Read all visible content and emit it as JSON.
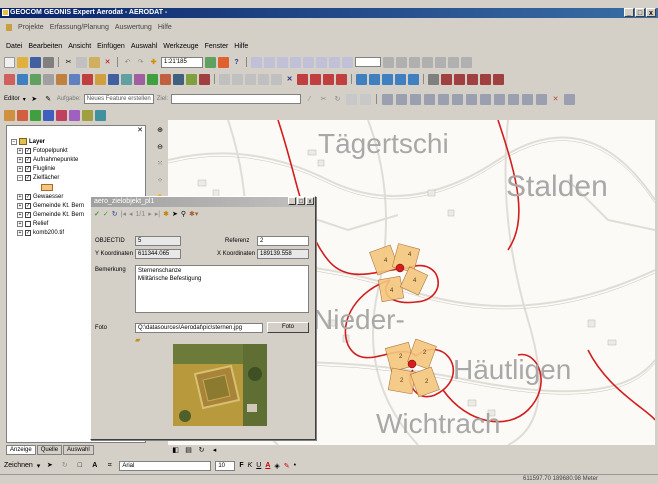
{
  "window": {
    "title": "GEOCOM GEONIS Expert Aerodat - AERODAT -",
    "buttons": {
      "minimize": "_",
      "maximize": "□",
      "close": "x"
    }
  },
  "app_menu": {
    "items": [
      "Projekte",
      "Erfassung/Planung",
      "Auswertung",
      "Hilfe"
    ]
  },
  "main_menu": {
    "items": [
      "Datei",
      "Bearbeiten",
      "Ansicht",
      "Einfügen",
      "Auswahl",
      "Werkzeuge",
      "Fenster",
      "Hilfe"
    ]
  },
  "toolbar": {
    "scale_value": "1:21'185"
  },
  "editor": {
    "label": "Editor",
    "task_label": "Aufgabe:",
    "task_value": "Neues Feature erstellen",
    "target_label": "Ziel:"
  },
  "toc": {
    "root": "Layer",
    "layers": [
      {
        "name": "Fotopelpunkt",
        "checked": true
      },
      {
        "name": "Aufnahmepunkte",
        "checked": true
      },
      {
        "name": "Fluglinie",
        "checked": true
      },
      {
        "name": "Zielfächer",
        "checked": true
      },
      {
        "name": "Gewaesser",
        "checked": true
      },
      {
        "name": "Gemeinde Kt. Bern",
        "checked": true
      },
      {
        "name": "Gemeinde Kt. Bern",
        "checked": true
      },
      {
        "name": "Relief",
        "checked": false
      },
      {
        "name": "komb200.tif",
        "checked": true
      }
    ],
    "tabs": [
      "Anzeige",
      "Quelle",
      "Auswahl"
    ]
  },
  "map": {
    "labels": [
      "Tägertschi",
      "Stalden",
      "Nieder-",
      "Häutligen",
      "Wichtrach"
    ],
    "zone_numbers": [
      "4",
      "4",
      "4",
      "4",
      "2",
      "2",
      "2",
      "2"
    ],
    "colors": {
      "route": "#d21e1e",
      "fan": "#f5c77e",
      "fan_edge": "#a86a30",
      "road": "#e0ddd6"
    }
  },
  "dialog": {
    "title": "aero_zielobjekt_pl1",
    "record": "1/1",
    "objectid_label": "OBJECTID",
    "objectid_value": "5",
    "referenz_label": "Referenz",
    "referenz_value": "2",
    "y_label": "Y Koordinaten",
    "y_value": "611344.065",
    "x_label": "X Koordinaten",
    "x_value": "189139.558",
    "bemerkung_label": "Bemerkung",
    "bemerkung_line1": "Sternenschanze",
    "bemerkung_line2": "Militärische Befestigung",
    "foto_label": "Foto",
    "foto_path": "Q:\\datasources\\Aerodat\\pic\\sternen.jpg",
    "foto_button": "Foto"
  },
  "drawing": {
    "label": "Zeichnen",
    "font": "Arial",
    "size": "10",
    "bold": "F",
    "italic": "K",
    "underline": "U"
  },
  "status": {
    "coords": "611597.70  189680.98 Meter"
  }
}
